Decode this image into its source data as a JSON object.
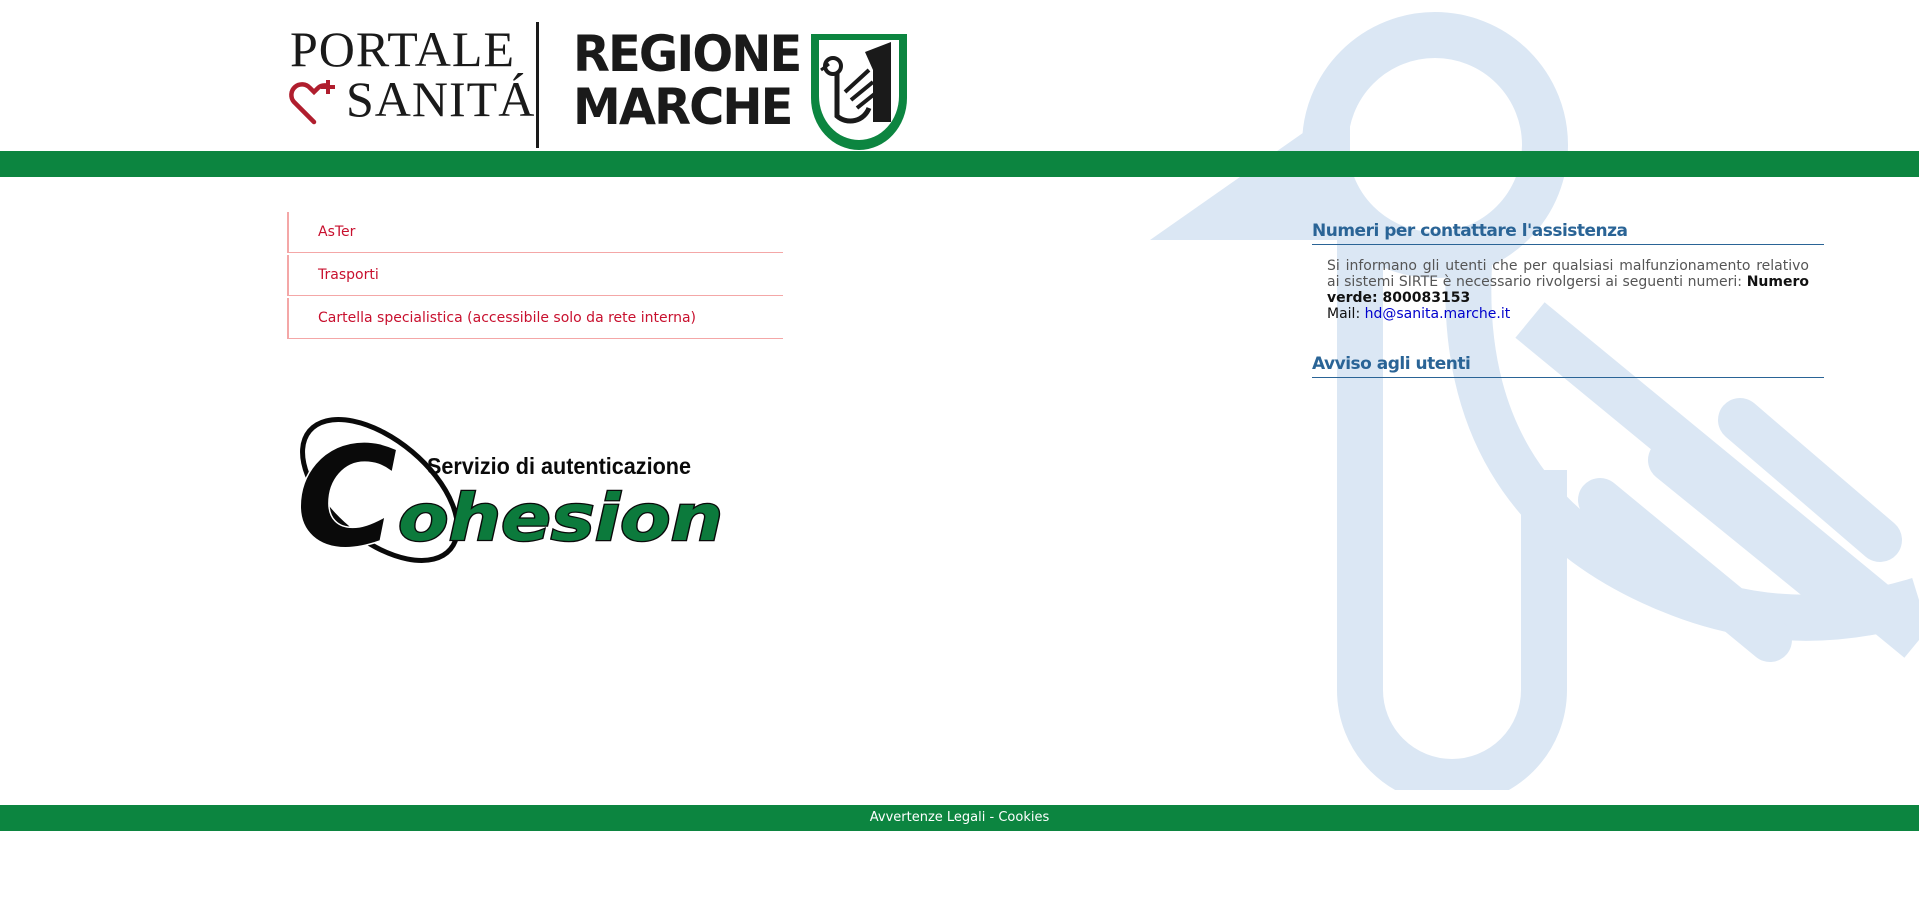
{
  "header": {
    "portale_line1": "PORTALE",
    "portale_line2": "SANITÁ",
    "regione_line1": "REGIONE",
    "regione_line2": "MARCHE"
  },
  "menu": {
    "items": [
      {
        "label": "AsTer"
      },
      {
        "label": "Trasporti"
      },
      {
        "label": "Cartella specialistica (accessibile solo da rete interna)"
      }
    ]
  },
  "cohesion": {
    "subtitle": "Servizio di autenticazione",
    "name": "ohesion",
    "initial": "C"
  },
  "assistance": {
    "title": "Numeri per contattare l'assistenza",
    "text": "Si informano gli utenti che per qualsiasi malfunzionamento relativo ai sistemi SIRTE è necessario rivolgersi ai seguenti numeri:",
    "phone_label": "Numero verde: 800083153",
    "mail_label": "Mail:",
    "mail_value": "hd@sanita.marche.it"
  },
  "notice": {
    "title": "Avviso agli utenti"
  },
  "footer": {
    "legal": "Avvertenze Legali",
    "separator": " - ",
    "cookies": "Cookies"
  },
  "colors": {
    "green": "#0c8540",
    "menu_text": "#c8102e",
    "heading": "#2a6496",
    "watermark": "#dbe7f4"
  }
}
